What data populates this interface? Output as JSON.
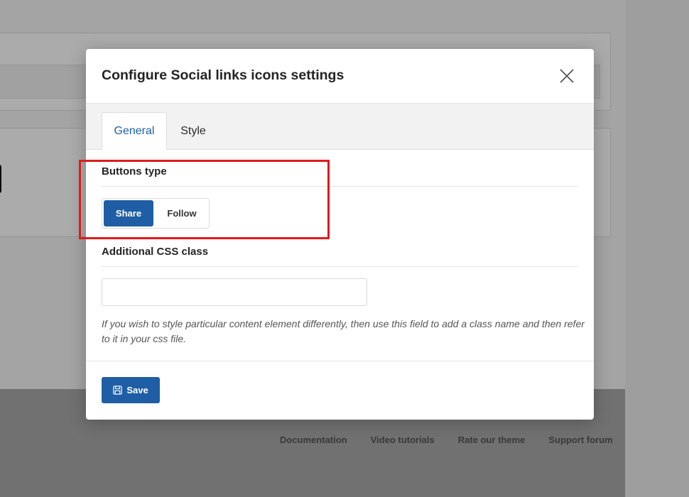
{
  "background": {
    "footer_links": [
      "Documentation",
      "Video tutorials",
      "Rate our theme",
      "Support forum"
    ]
  },
  "modal": {
    "title": "Configure Social links icons settings",
    "close_icon": "close-icon",
    "tabs": [
      {
        "label": "General",
        "active": true
      },
      {
        "label": "Style",
        "active": false
      }
    ],
    "buttons_type": {
      "label": "Buttons type",
      "options": [
        {
          "label": "Share",
          "selected": true
        },
        {
          "label": "Follow",
          "selected": false
        }
      ]
    },
    "css_class": {
      "label": "Additional CSS class",
      "value": "",
      "placeholder": "",
      "help": "If you wish to style particular content element differently, then use this field to add a class name and then refer to it in your css file."
    },
    "footer": {
      "save_label": "Save",
      "save_icon": "save-icon"
    }
  },
  "colors": {
    "accent": "#1f5ea5",
    "active_tab_text": "#1e5fa8",
    "highlight": "#e01b1b"
  }
}
